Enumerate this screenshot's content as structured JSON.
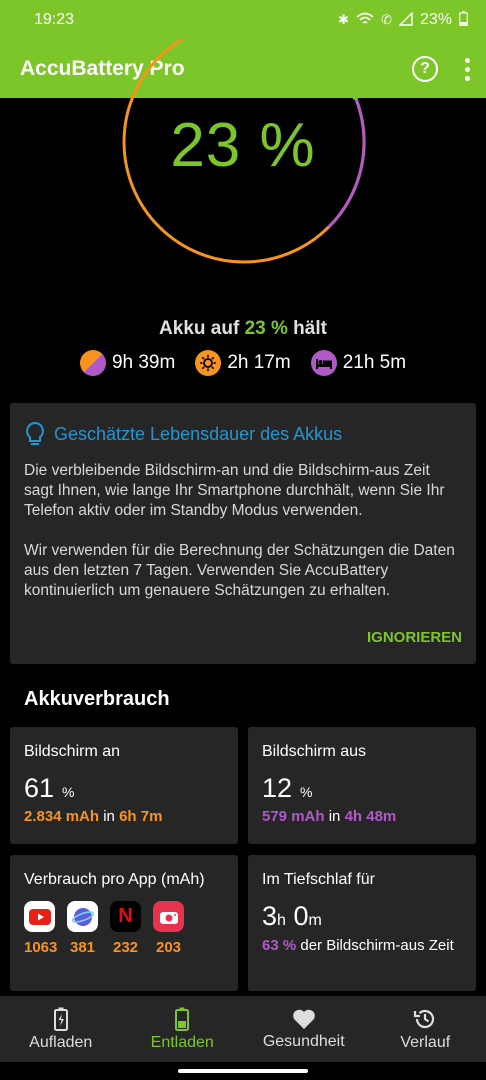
{
  "status": {
    "time": "19:23",
    "battery": "23%"
  },
  "app": {
    "title": "AccuBattery Pro"
  },
  "gauge": {
    "percent": "23 %",
    "level": 0.23
  },
  "akku": {
    "prefix": "Akku auf",
    "value": "23 %",
    "suffix": "hält"
  },
  "times": {
    "mixed": "9h 39m",
    "screen_on": "2h 17m",
    "standby": "21h 5m"
  },
  "info": {
    "title": "Geschätzte Lebensdauer des Akkus",
    "p1": "Die verbleibende Bildschirm-an und die Bildschirm-aus Zeit sagt Ihnen, wie lange Ihr Smartphone durchhält, wenn Sie Ihr Telefon aktiv oder im Standby Modus verwenden.",
    "p2": "Wir verwenden für die Berechnung der Schätzungen die Daten aus den letzten 7 Tagen. Verwenden Sie AccuBattery kontinuierlich um genauere Schätzungen zu erhalten.",
    "ignore": "IGNORIEREN"
  },
  "section_title": "Akkuverbrauch",
  "screen_on": {
    "label": "Bildschirm an",
    "value": "61",
    "unit": "%",
    "mah": "2.834 mAh",
    "in": "in",
    "time": "6h 7m"
  },
  "screen_off": {
    "label": "Bildschirm aus",
    "value": "12",
    "unit": "%",
    "mah": "579 mAh",
    "in": "in",
    "time": "4h 48m"
  },
  "per_app": {
    "label": "Verbrauch pro App (mAh)",
    "apps": [
      {
        "icon": "youtube-icon",
        "value": "1063"
      },
      {
        "icon": "samsung-internet-icon",
        "value": "381"
      },
      {
        "icon": "netflix-icon",
        "value": "232"
      },
      {
        "icon": "camera-icon",
        "value": "203"
      }
    ]
  },
  "deep_sleep": {
    "label": "Im Tiefschlaf für",
    "h": "3",
    "h_unit": "h",
    "m": "0",
    "m_unit": "m",
    "pct": "63 %",
    "rest": "der Bildschirm-aus Zeit"
  },
  "nav": {
    "charge": "Aufladen",
    "discharge": "Entladen",
    "health": "Gesundheit",
    "history": "Verlauf"
  },
  "colors": {
    "accent": "#7cc62a",
    "orange": "#f7941e",
    "purple": "#b159c8",
    "blue": "#2196d3"
  }
}
